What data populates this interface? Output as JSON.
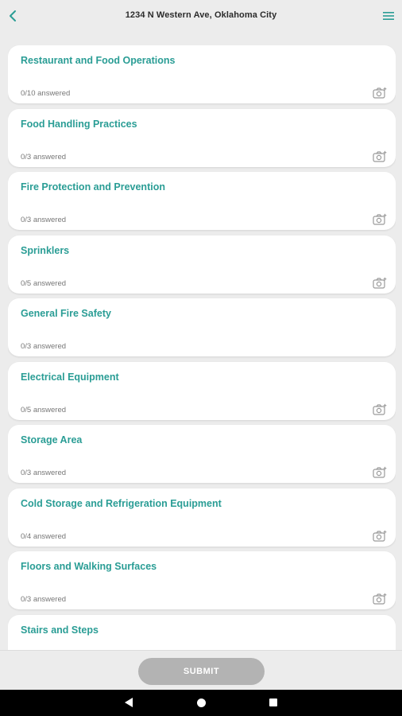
{
  "appbar": {
    "title": "1234 N Western Ave, Oklahoma City",
    "back_icon": "chevron-left-icon",
    "menu_icon": "hamburger-menu-icon"
  },
  "sections": [
    {
      "title": "Restaurant and Food Operations",
      "count": "0/10 answered",
      "has_camera": true
    },
    {
      "title": "Food Handling Practices",
      "count": "0/3 answered",
      "has_camera": true
    },
    {
      "title": "Fire Protection and Prevention",
      "count": "0/3 answered",
      "has_camera": true
    },
    {
      "title": "Sprinklers",
      "count": "0/5 answered",
      "has_camera": true
    },
    {
      "title": "General Fire Safety",
      "count": "0/3 answered",
      "has_camera": false
    },
    {
      "title": "Electrical Equipment",
      "count": "0/5 answered",
      "has_camera": true
    },
    {
      "title": "Storage Area",
      "count": "0/3 answered",
      "has_camera": true
    },
    {
      "title": "Cold Storage and Refrigeration Equipment",
      "count": "0/4 answered",
      "has_camera": true
    },
    {
      "title": "Floors and Walking Surfaces",
      "count": "0/3 answered",
      "has_camera": true
    },
    {
      "title": "Stairs and Steps",
      "count": "",
      "has_camera": false
    }
  ],
  "footer": {
    "submit_label": "SUBMIT"
  },
  "colors": {
    "accent": "#2a9d95",
    "background": "#ececec",
    "submit_disabled": "#b3b3b3"
  }
}
